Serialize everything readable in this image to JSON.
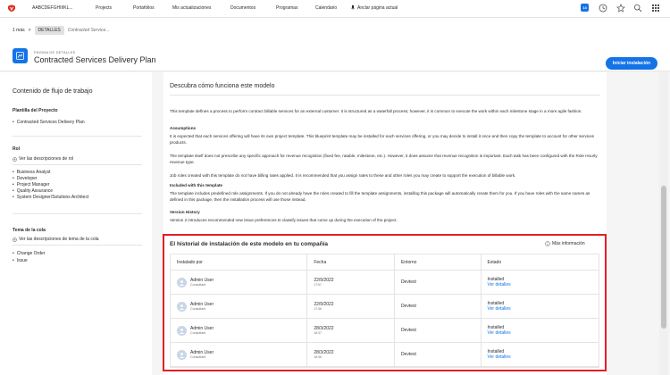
{
  "topnav": {
    "brand": "AABCDEFGHIIIKL...",
    "items": [
      "Projects",
      "Portafolios",
      "Mis actualizaciones",
      "Documentos",
      "Programas",
      "Calendario"
    ],
    "pin_label": "Anclar página actual",
    "badge": "14"
  },
  "header": {
    "breadcrumb_more": "1 más",
    "breadcrumb_sep": ">",
    "breadcrumb_current": "DETALLES",
    "breadcrumb_page": "Contracted Service...",
    "eyebrow": "PÁGINA DE DETALLES",
    "title": "Contracted Services Delivery Plan",
    "install_button": "Iniciar instalación"
  },
  "sidebar": {
    "title": "Contenido de flujo de trabajo",
    "project_heading": "Plantilla del Proyecto",
    "project_items": [
      "Contracted Services Delivery Plan"
    ],
    "role_heading": "Rol",
    "role_link": "Ver las descripciones de rol",
    "role_items": [
      "Business Analyst",
      "Developer",
      "Project Manager",
      "Quality Assurance",
      "System Designer/Solutions Architect"
    ],
    "queue_heading": "Tema de la cola",
    "queue_link": "Ver las descripciones de tema de la cola",
    "queue_items": [
      "Change Order",
      "Issue"
    ]
  },
  "main": {
    "section_title": "Descubra cómo funciona este modelo",
    "intro": "This template defines a process to perform contract billable services for an external customer. It is structured as a waterfall process; however, it is common to execute the work within each milestone stage in a more agile fashion.",
    "assumptions_heading": "Assumptions",
    "assumptions_p1": "It is expected that each services offering will have its own project template. This blueprint template may be installed for each services offering, or you may decide to install it once and then copy the template to account for other services products.",
    "assumptions_p2": "The template itself does not prescribe any specific approach for revenue recognition (fixed fee, ratable, milestone, etc.). However, it does assume that revenue recognition is important. Each task has been configured with the Role Hourly revenue type.",
    "assumptions_p3": "Job roles created with this template do not have billing rates applied. It is recommended that you assign rates to these and other roles you may create to support the execution of billable work.",
    "included_heading": "Included with this template",
    "included_p": "The template includes predefined role assignments. If you do not already have the roles created to fill the template assignments, installing this package will automatically create them for you. If you have roles with the same names as defined in this package, then the installation process will use those instead.",
    "version_heading": "Version History",
    "version_p": "Version 2 introduces recommended new issue preferences to classify issues that come up during the execution of the project."
  },
  "history": {
    "title": "El historial de instalación de este modelo en tu compañía",
    "more_info": "Más información",
    "columns": [
      "Instalado por",
      "Fecha",
      "Entorno",
      "Estado"
    ],
    "rows": [
      {
        "user": "Admin User",
        "role": "Consultant",
        "date": "22/9/2022",
        "time": "17:57",
        "env": "Devtest",
        "status": "Installed",
        "details": "Ver detalles"
      },
      {
        "user": "Admin User",
        "role": "Consultant",
        "date": "22/9/2022",
        "time": "17:36",
        "env": "Devtest",
        "status": "Installed",
        "details": "Ver detalles"
      },
      {
        "user": "Admin User",
        "role": "Consultant",
        "date": "28/3/2022",
        "time": "16:37",
        "env": "Devtest",
        "status": "Installed",
        "details": "Ver detalles"
      },
      {
        "user": "Admin User",
        "role": "Consultant",
        "date": "28/3/2022",
        "time": "16:36",
        "env": "Devtest",
        "status": "Installed",
        "details": "Ver detalles"
      }
    ]
  },
  "colors": {
    "accent": "#1473e6",
    "highlight_border": "#e41e26",
    "brand_red": "#e0311f"
  }
}
